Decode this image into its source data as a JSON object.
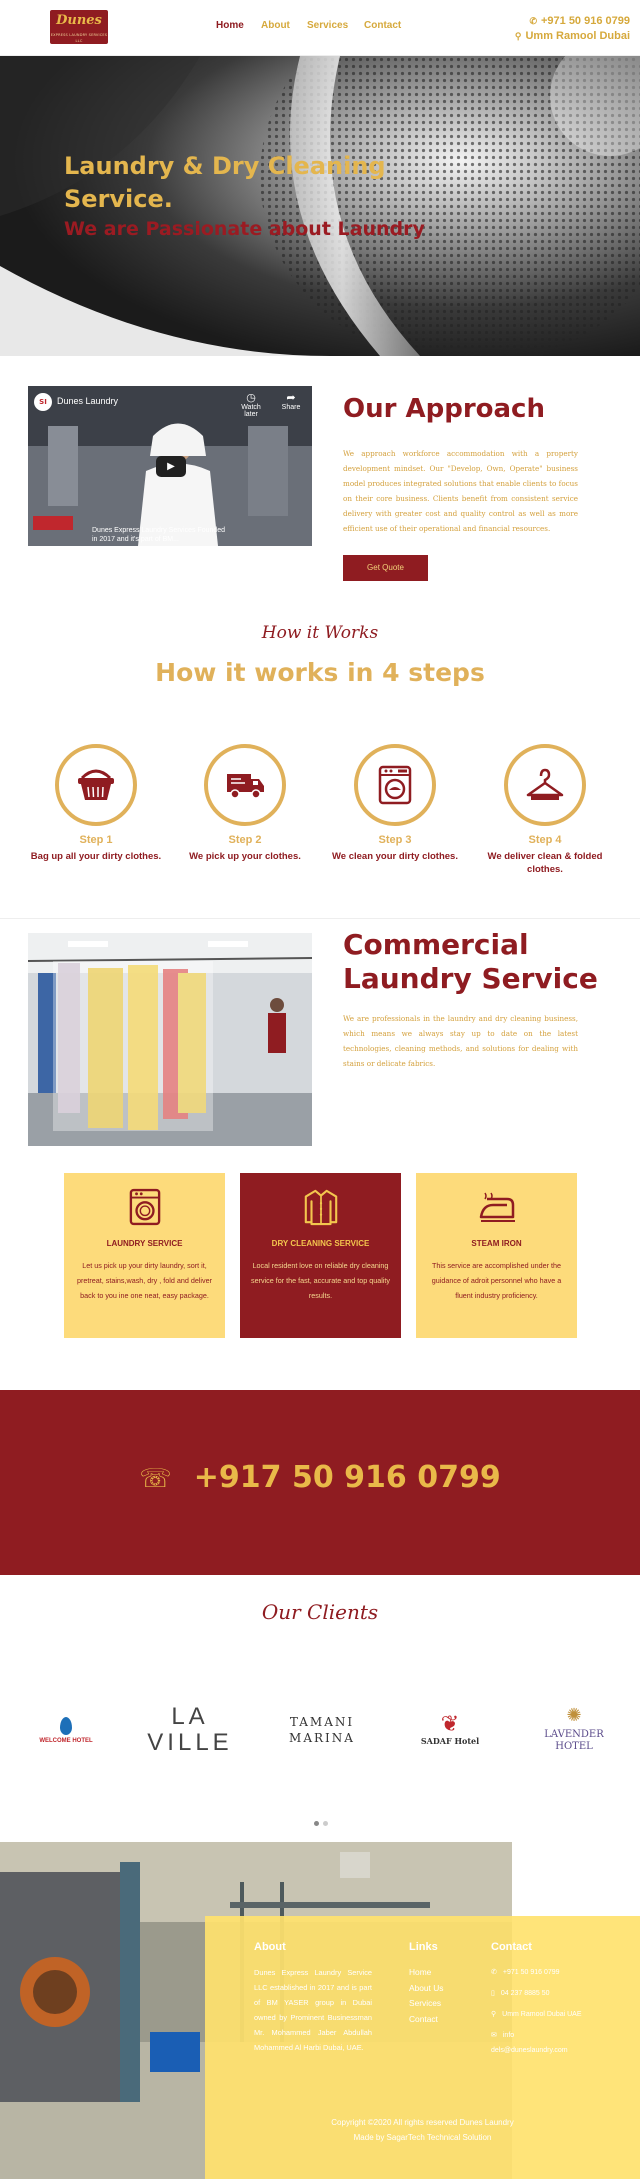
{
  "header": {
    "logo_text": "Dunes",
    "logo_sub": "EXPRESS LAUNDRY SERVICES LLC",
    "nav": [
      {
        "label": "Home",
        "active": true
      },
      {
        "label": "About",
        "active": false
      },
      {
        "label": "Services",
        "active": false
      },
      {
        "label": "Contact",
        "active": false
      }
    ],
    "phone": "+971 50 916 0799",
    "location": "Umm Ramool Dubai"
  },
  "hero": {
    "title": "Laundry & Dry Cleaning Service.",
    "subtitle": "We are Passionate about Laundry"
  },
  "approach": {
    "video_channel": "Dunes Laundry",
    "video_watch_later": "Watch later",
    "video_share": "Share",
    "video_caption": "Dunes Express Laundry Services Founded in 2017 and it's part of BM...",
    "title": "Our Approach",
    "text": "We approach workforce accommodation with a property development mindset. Our \"Develop, Own, Operate\" business model produces integrated solutions that enable clients to focus on their core business. Clients benefit from consistent service delivery with greater cost and quality control as well as more efficient use of their operational and financial resources.",
    "button": "Get Quote"
  },
  "how": {
    "script": "How it Works",
    "title": "How it works in 4 steps",
    "steps": [
      {
        "num": "Step 1",
        "desc": "Bag up all your dirty clothes.",
        "icon": "laundry-basket-icon"
      },
      {
        "num": "Step 2",
        "desc": "We pick up your clothes.",
        "icon": "delivery-truck-icon"
      },
      {
        "num": "Step 3",
        "desc": "We clean your dirty clothes.",
        "icon": "washing-machine-icon"
      },
      {
        "num": "Step 4",
        "desc": "We deliver clean & folded clothes.",
        "icon": "hanger-icon"
      }
    ]
  },
  "commercial": {
    "title": "Commercial Laundry Service",
    "text": "We are professionals in the laundry and dry cleaning business, which means we always stay up to date on the latest technologies, cleaning methods, and solutions for dealing with stains or delicate fabrics."
  },
  "services": [
    {
      "title": "LAUNDRY SERVICE",
      "text": "Let us pick up your dirty laundry, sort it, pretreat, stains,wash, dry , fold and deliver back to you ine one neat, easy package.",
      "icon": "washing-machine-icon"
    },
    {
      "title": "DRY CLEANING SERVICE",
      "text": "Local resident love on reliable dry cleaning service for the fast, accurate and top quality results.",
      "icon": "shirt-icon"
    },
    {
      "title": "STEAM IRON",
      "text": "This service are accomplished under the guidance of adroit personnel who have a fluent industry proficiency.",
      "icon": "iron-icon"
    }
  ],
  "band": {
    "phone": "+917 50 916 0799"
  },
  "clients": {
    "script": "Our Clients",
    "logos": [
      "WELCOME HOTEL",
      "LA VILLE",
      "TAMANI MARINA",
      "SADAF Hotel",
      "LAVENDER HOTEL"
    ]
  },
  "footer": {
    "about_title": "About",
    "about_text": "Dunes Express Laundry Service LLC established in 2017 and is part of BM YASER group in Dubai owned by Prominent Businessman Mr. Mohammed Jaber Abdullah Mohammed Al Harbi Dubai, UAE.",
    "links_title": "Links",
    "links": [
      "Home",
      "About Us",
      "Services",
      "Contact"
    ],
    "contact_title": "Contact",
    "contact_phone": "+971 50 916 0799",
    "contact_phone2": "04 237 8885 50",
    "contact_address": "Umm Ramool Dubai UAE",
    "contact_email_label": "info",
    "contact_email": "dels@duneslaundry.com",
    "copyright": "Copyright ©2020 All rights reserved Dunes Laundry",
    "made_by": "Made by SagarTech Technical Solution"
  },
  "colors": {
    "maroon": "#8f1c21",
    "gold": "#e0b15a",
    "yellow_card": "#fddb7b"
  }
}
